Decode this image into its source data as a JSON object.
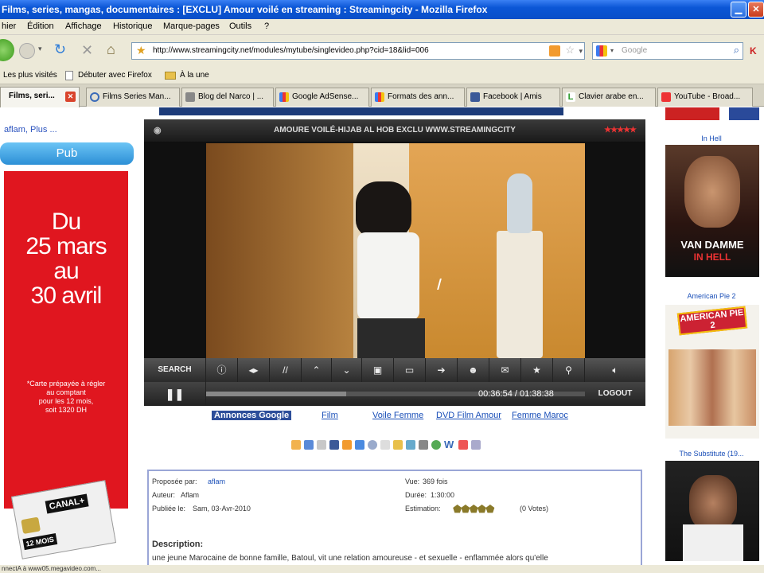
{
  "window": {
    "title": "Films, series, mangas, documentaires : [EXCLU] Amour voilé en streaming : Streamingcity - Mozilla Firefox"
  },
  "menu": [
    "hier",
    "Édition",
    "Affichage",
    "Historique",
    "Marque-pages",
    "Outils",
    "?"
  ],
  "nav": {
    "url": "http://www.streamingcity.net/modules/mytube/singlevideo.php?cid=18&lid=006",
    "search_placeholder": "Google"
  },
  "bookmarks": [
    "Les plus visités",
    "Débuter avec Firefox",
    "À la une"
  ],
  "tabs": [
    "Films, seri...",
    "Films Series Man...",
    "Blog del Narco | ...",
    "Google AdSense...",
    "Formats des ann...",
    "Facebook | Amis",
    "Clavier arabe en...",
    "YouTube - Broad..."
  ],
  "sidebar": {
    "link": "aflam, Plus ...",
    "pub_button": "Pub",
    "ad": {
      "line1": "Du",
      "line2": "25 mars",
      "line3": "au",
      "line4": "30 avril",
      "note1": "*Carte prépayée à régler",
      "note2": "au comptant",
      "note3": "pour les 12 mois,",
      "note4": "soit 1320 DH",
      "brand": "CANAL+",
      "months": "12 MOIS"
    }
  },
  "player": {
    "title": "AMOURE VOILÉ-HIJAB AL HOB EXCLU WWW.STREAMINGCITY",
    "search_label": "SEARCH",
    "logout_label": "LOGOUT",
    "time_current": "00:36:54",
    "time_total": "01:38:38",
    "time_separator": "/",
    "progress": 0.37
  },
  "ad_links": {
    "label": "Annonces Google",
    "links": [
      "Film",
      "Voile Femme",
      "DVD Film Amour",
      "Femme Maroc"
    ]
  },
  "info": {
    "proposee_label": "Proposée par:",
    "proposee_value": "aflam",
    "auteur_label": "Auteur:",
    "auteur_value": "Aflam",
    "publiee_label": "Publiée le:",
    "publiee_value": "Sam, 03-Avr-2010",
    "vue_label": "Vue:",
    "vue_value": "369 fois",
    "duree_label": "Durée:",
    "duree_value": "1:30:00",
    "estimation_label": "Estimation:",
    "votes": "(0 Votes)",
    "description_label": "Description:",
    "description": "une jeune Marocaine de bonne famille, Batoul, vit une relation amoureuse - et sexuelle - enflammée alors qu'elle"
  },
  "right": {
    "poster1_title": "In Hell",
    "poster1_text1": "VAN DAMME",
    "poster1_text2": "IN HELL",
    "poster2_title": "American Pie 2",
    "poster2_text": "AMERICAN PIE 2",
    "poster3_title": "The Substitute (19..."
  },
  "status": "nnectA à www05.megavideo.com...",
  "colors": {
    "titlebar": "#0b56d6",
    "ad_red": "#e0161f",
    "pub_blue": "#2c8fd6",
    "link_blue": "#1a4fb8"
  }
}
